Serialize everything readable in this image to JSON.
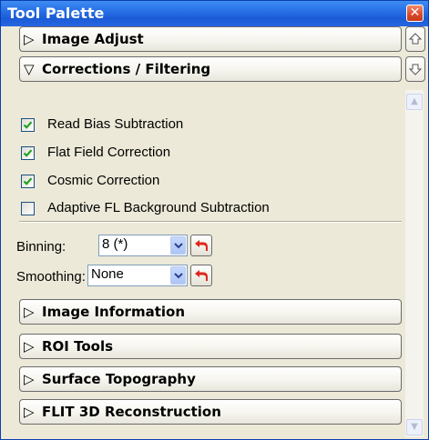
{
  "window": {
    "title": "Tool Palette",
    "close_glyph": "✕"
  },
  "sections": [
    {
      "label": "Image Adjust",
      "expanded": false,
      "arrow": "▷"
    },
    {
      "label": "Corrections / Filtering",
      "expanded": true,
      "arrow": "▽"
    },
    {
      "label": "Image Information",
      "expanded": false,
      "arrow": "▷"
    },
    {
      "label": "ROI Tools",
      "expanded": false,
      "arrow": "▷"
    },
    {
      "label": "Surface Topography",
      "expanded": false,
      "arrow": "▷"
    },
    {
      "label": "FLIT 3D Reconstruction",
      "expanded": false,
      "arrow": "▷"
    }
  ],
  "corrections": {
    "options": [
      {
        "label": "Read Bias Subtraction",
        "checked": true
      },
      {
        "label": "Flat Field Correction",
        "checked": true
      },
      {
        "label": "Cosmic Correction",
        "checked": true
      },
      {
        "label": "Adaptive FL Background Subtraction",
        "checked": false
      }
    ],
    "binning": {
      "label": "Binning:",
      "value": "8 (*)"
    },
    "smoothing": {
      "label": "Smoothing:",
      "value": "None"
    }
  },
  "icons": {
    "nav_up": "up-arrow-icon",
    "nav_down": "down-arrow-icon",
    "reset": "undo-arrow-icon",
    "dropdown": "chevron-down-icon",
    "check": "checkmark-icon"
  },
  "colors": {
    "titlebar": "#2a73e8",
    "close_button": "#d9482a",
    "panel_background": "#ece9d8",
    "checkmark": "#21a121",
    "reset_arrow": "#e0261c",
    "dropdown_button": "#aec6f6"
  }
}
